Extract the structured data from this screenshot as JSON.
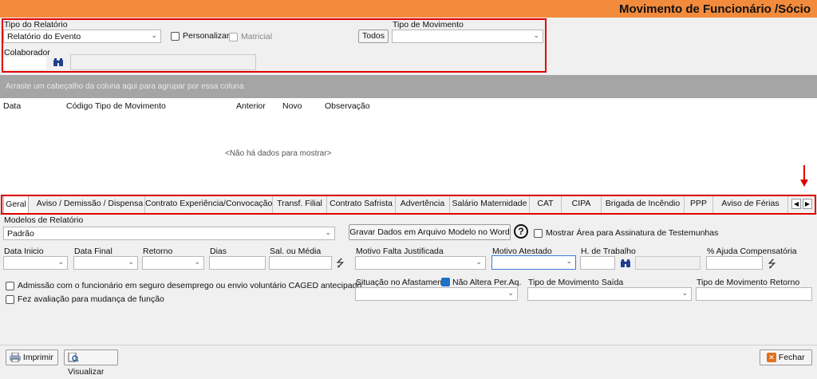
{
  "window": {
    "title": "Movimento de Funcionário /Sócio"
  },
  "filters": {
    "tipo_relatorio_label": "Tipo do Relatório",
    "tipo_relatorio_value": "Relatório do Evento",
    "personalizar_label": "Personalizar",
    "matricial_label": "Matricial",
    "todos_label": "Todos",
    "tipo_movimento_label": "Tipo de Movimento",
    "tipo_movimento_value": "",
    "colaborador_label": "Colaborador"
  },
  "grid": {
    "group_hint": "Arraste um cabeçalho da coluna aqui para agrupar por essa coluna",
    "columns": [
      "Data",
      "Código",
      "Tipo de Movimento",
      "Anterior",
      "Novo",
      "Observação"
    ],
    "empty_text": "<Não há dados para mostrar>"
  },
  "tabs": [
    "Geral",
    "Aviso / Demissão / Dispensa",
    "Contrato Experiência/Convocação",
    "Transf. Filial",
    "Contrato Safrista",
    "Advertência",
    "Salário Maternidade",
    "CAT",
    "CIPA",
    "Brigada de Incêndio",
    "PPP",
    "Aviso de Férias"
  ],
  "tabs_active": "Geral",
  "form": {
    "modelos_label": "Modelos de Relatório",
    "modelos_value": "Padrão",
    "gravar_label": "Gravar Dados em Arquivo Modelo no Word",
    "help_symbol": "?",
    "mostrar_area_label": "Mostrar Área para Assinatura de Testemunhas",
    "data_inicio_label": "Data Inicio",
    "data_final_label": "Data Final",
    "retorno_label": "Retorno",
    "dias_label": "Dias",
    "sal_media_label": "Sal. ou Média",
    "motivo_falta_label": "Motivo Falta Justificada",
    "motivo_atestado_label": "Motivo Atestado",
    "h_trabalho_label": "H. de Trabalho",
    "ajuda_label": "% Ajuda Compensatória",
    "admissao_label": "Admissão com o funcionário em seguro desemprego ou envio voluntário CAGED antecipado",
    "avaliacao_label": "Fez avaliação para mudança de função",
    "situacao_label": "Situação no Afastamento",
    "nao_altera_label": "Não Altera Per.Aq.",
    "tipo_mov_saida_label": "Tipo de Movimento Saída",
    "tipo_mov_retorno_label": "Tipo de Movimento Retorno"
  },
  "footer": {
    "imprimir_label": "Imprimir",
    "visualizar_label": "Visualizar",
    "fechar_label": "Fechar"
  },
  "colors": {
    "titlebar": "#f28b3c",
    "highlight": "#e00000",
    "checked": "#1e6fc8"
  }
}
